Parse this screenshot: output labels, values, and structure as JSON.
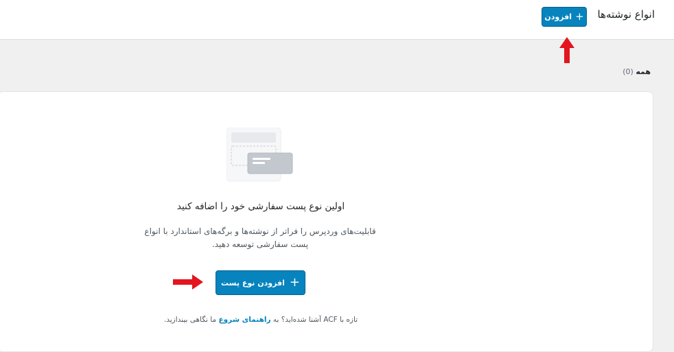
{
  "header": {
    "title": "انواع نوشته‌ها",
    "add_label": "افزودن",
    "plus_icon": "+"
  },
  "filters": {
    "all_label": "همه",
    "all_count": "(0)"
  },
  "empty_state": {
    "title": "اولین نوع پست سفارشی خود را اضافه کنید",
    "description_line1": "قابلیت‌های وردپرس را فراتر از نوشته‌ها و برگه‌های استاندارد با انواع",
    "description_line2": "پست سفارشی توسعه دهید.",
    "button_label": "افزودن نوع پست",
    "plus_icon": "+"
  },
  "footer": {
    "prefix": "تازه با ACF آشنا شده‌اید؟ به",
    "link_label": "راهنمای شروع",
    "suffix": "ما نگاهی بیندازید."
  },
  "colors": {
    "accent": "#0783be",
    "annotation_arrow": "#e3151e",
    "background": "#f0f0f1"
  }
}
